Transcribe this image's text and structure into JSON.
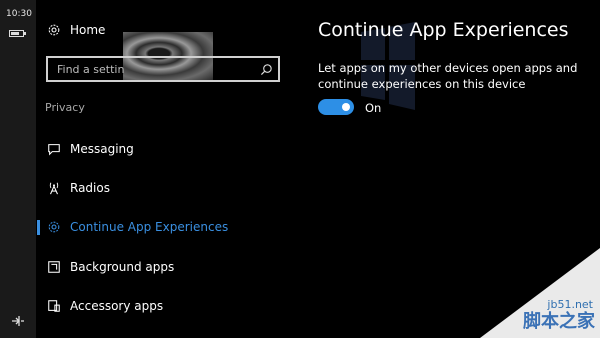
{
  "status": {
    "time": "10:30",
    "battery_level": 0.75
  },
  "nav": {
    "home_label": "Home",
    "search_placeholder": "Find a settin",
    "section_label": "Privacy",
    "items": [
      {
        "label": "Messaging",
        "icon": "message-icon"
      },
      {
        "label": "Radios",
        "icon": "radio-tower-icon"
      },
      {
        "label": "Continue App Experiences",
        "icon": "gear-icon",
        "selected": true
      },
      {
        "label": "Background apps",
        "icon": "background-apps-icon"
      },
      {
        "label": "Accessory apps",
        "icon": "accessory-apps-icon"
      }
    ]
  },
  "content": {
    "title": "Continue App Experiences",
    "description": "Let apps on my other devices open apps and continue experiences on this device",
    "toggle_on": true,
    "toggle_label": "On"
  },
  "watermark": {
    "site": "jb51.net",
    "name": "脚本之家"
  },
  "colors": {
    "accent": "#2d8fe6",
    "background": "#000000",
    "rail": "#1a1a1a"
  }
}
